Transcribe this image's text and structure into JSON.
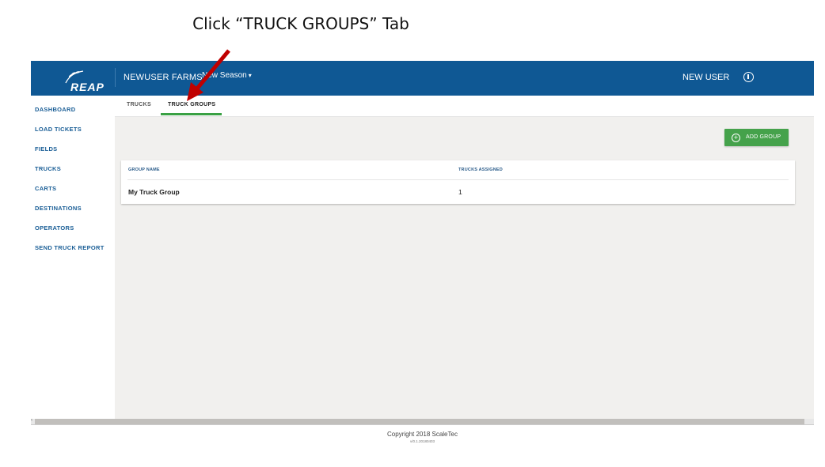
{
  "instruction": "Click “TRUCK GROUPS” Tab",
  "header": {
    "logo_text": "REAP",
    "farm": "NEWUSER FARMS",
    "season": "New Season",
    "user": "NEW USER"
  },
  "sidebar": {
    "items": [
      {
        "label": "DASHBOARD"
      },
      {
        "label": "LOAD TICKETS"
      },
      {
        "label": "FIELDS"
      },
      {
        "label": "TRUCKS"
      },
      {
        "label": "CARTS"
      },
      {
        "label": "DESTINATIONS"
      },
      {
        "label": "OPERATORS"
      },
      {
        "label": "SEND TRUCK REPORT"
      }
    ]
  },
  "tabs": [
    {
      "label": "TRUCKS",
      "active": false
    },
    {
      "label": "TRUCK GROUPS",
      "active": true
    }
  ],
  "actions": {
    "add_group_label": "ADD GROUP"
  },
  "table": {
    "columns": [
      "GROUP NAME",
      "TRUCKS ASSIGNED"
    ],
    "rows": [
      {
        "name": "My Truck Group",
        "trucks_assigned": "1"
      }
    ]
  },
  "footer": {
    "copyright": "Copyright 2018 ScaleTec",
    "version": "v/0.1.20180403"
  },
  "colors": {
    "header": "#0f5894",
    "accent_green": "#45a24b",
    "nav_text": "#1a5e96",
    "annotation_arrow": "#c00000"
  },
  "icons": {
    "user": "user-circle-icon",
    "add": "plus-circle-icon",
    "logo": "wheat-icon"
  }
}
